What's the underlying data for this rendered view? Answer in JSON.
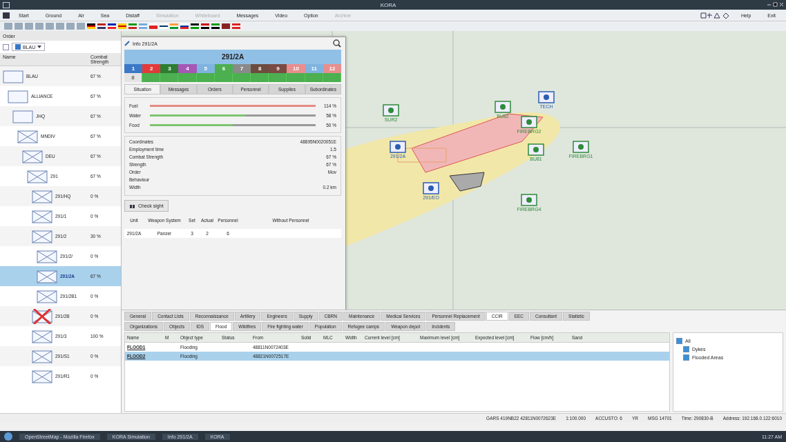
{
  "window": {
    "title": "KORA"
  },
  "menu": {
    "items": [
      {
        "label": "Start",
        "disabled": false
      },
      {
        "label": "Ground",
        "disabled": false
      },
      {
        "label": "Air",
        "disabled": false
      },
      {
        "label": "Sea",
        "disabled": false
      },
      {
        "label": "Distaff",
        "disabled": false
      },
      {
        "label": "Simulation",
        "disabled": true
      },
      {
        "label": "Whiteboard",
        "disabled": true
      },
      {
        "label": "Messages",
        "disabled": false
      },
      {
        "label": "Video",
        "disabled": false
      },
      {
        "label": "Option",
        "disabled": false
      },
      {
        "label": "Archive",
        "disabled": true
      }
    ],
    "right_items": [
      "Help",
      "Exit"
    ]
  },
  "order_panel": {
    "title": "Order",
    "side_dropdown": "BLAU",
    "columns": [
      "Name",
      "Combat Strength"
    ],
    "tree": [
      {
        "name": "BLAU",
        "strength": "67 %",
        "selected": false,
        "destroyed": false,
        "children": [
          {
            "name": "ALLIANCE",
            "strength": "67 %",
            "selected": false,
            "destroyed": false,
            "children": [
              {
                "name": "JHQ",
                "strength": "67 %",
                "selected": false,
                "destroyed": false,
                "children": [
                  {
                    "name": "MNDIV",
                    "strength": "67 %",
                    "selected": false,
                    "destroyed": false,
                    "children": [
                      {
                        "name": "DEU",
                        "strength": "67 %",
                        "selected": false,
                        "destroyed": false,
                        "children": [
                          {
                            "name": "291",
                            "strength": "67 %",
                            "selected": false,
                            "destroyed": false,
                            "children": [
                              {
                                "name": "291/HQ",
                                "strength": "0 %",
                                "selected": false,
                                "destroyed": false
                              },
                              {
                                "name": "291/1",
                                "strength": "0 %",
                                "selected": false,
                                "destroyed": false
                              },
                              {
                                "name": "291/2",
                                "strength": "30 %",
                                "selected": false,
                                "destroyed": false,
                                "children": [
                                  {
                                    "name": "291/2/",
                                    "strength": "0 %",
                                    "selected": false,
                                    "destroyed": false
                                  },
                                  {
                                    "name": "291/2A",
                                    "strength": "67 %",
                                    "selected": true,
                                    "destroyed": false
                                  },
                                  {
                                    "name": "291/2B1",
                                    "strength": "0 %",
                                    "selected": false,
                                    "destroyed": false
                                  }
                                ]
                              },
                              {
                                "name": "291/2B",
                                "strength": "0 %",
                                "selected": false,
                                "destroyed": true
                              },
                              {
                                "name": "291/3",
                                "strength": "100 %",
                                "selected": false,
                                "destroyed": false
                              },
                              {
                                "name": "291/S1",
                                "strength": "0 %",
                                "selected": false,
                                "destroyed": false
                              },
                              {
                                "name": "291/R1",
                                "strength": "0 %",
                                "selected": false,
                                "destroyed": false
                              }
                            ]
                          }
                        ]
                      }
                    ]
                  }
                ]
              }
            ]
          }
        ]
      }
    ]
  },
  "map": {
    "units": [
      {
        "label": "TECH",
        "color": "#2a5db0"
      },
      {
        "label": "SUR2",
        "color": "#2e8b3a"
      },
      {
        "label": "BU82",
        "color": "#2e8b3a"
      },
      {
        "label": "FIREBRG2",
        "color": "#2e8b3a"
      },
      {
        "label": "BU81",
        "color": "#2e8b3a"
      },
      {
        "label": "FIREBRG1",
        "color": "#2e8b3a"
      },
      {
        "label": "FIREBRG4",
        "color": "#2e8b3a"
      },
      {
        "label": "291/2A",
        "color": "#2a5db0"
      },
      {
        "label": "291/EO",
        "color": "#2a5db0"
      }
    ]
  },
  "info_window": {
    "title": "Info 291/2A",
    "unit": "291/2A",
    "status_cells": [
      {
        "label": "1",
        "color": "#3a78c8"
      },
      {
        "label": "2",
        "color": "#e23a3a"
      },
      {
        "label": "3",
        "color": "#2e7d32"
      },
      {
        "label": "4",
        "color": "#a457b5"
      },
      {
        "label": "5",
        "color": "#7fb3e0"
      },
      {
        "label": "6",
        "color": "#4caf50"
      },
      {
        "label": "7",
        "color": "#8a8a8a"
      },
      {
        "label": "8",
        "color": "#6d4c3d"
      },
      {
        "label": "9",
        "color": "#7b4a42"
      },
      {
        "label": "10",
        "color": "#e88e8e"
      },
      {
        "label": "11",
        "color": "#7fb3e0"
      },
      {
        "label": "12",
        "color": "#e88e8e"
      }
    ],
    "row2_label": "8",
    "tabs": [
      {
        "label": "Situation",
        "selected": true
      },
      {
        "label": "Messages",
        "selected": false
      },
      {
        "label": "Orders",
        "selected": false
      },
      {
        "label": "Personnel",
        "selected": false
      },
      {
        "label": "Supplies",
        "selected": false
      },
      {
        "label": "Subordinates",
        "selected": false
      }
    ],
    "supplies": [
      {
        "name": "Fuel",
        "level": 1.0,
        "reading": "114 %",
        "color": "#e58a84"
      },
      {
        "name": "Water",
        "level": 0.58,
        "reading": "58 %",
        "color": "#7cc46e"
      },
      {
        "name": "Food",
        "level": 0.5,
        "reading": "50 %",
        "color": "#7cc46e"
      }
    ],
    "properties": [
      {
        "label": "Coordinates",
        "value": "48895N0020051E"
      },
      {
        "label": "Employment time",
        "value": "1.5"
      },
      {
        "label": "Combat Strength",
        "value": "67 %"
      },
      {
        "label": "Strength",
        "value": "67 %"
      },
      {
        "label": "Order",
        "value": "Mov"
      },
      {
        "label": "Behaviour"
      },
      {
        "label": "Width",
        "value": "0.2 km"
      }
    ],
    "check_sight_button": "Check sight",
    "weapons": {
      "columns": [
        "Unit",
        "Weapon System",
        "Set",
        "Actual",
        "Personnel",
        "Without Personnel"
      ],
      "rows": [
        [
          "291/2A",
          "Panzer",
          "3",
          "2",
          "6",
          ""
        ]
      ]
    }
  },
  "bottom": {
    "tabs": [
      {
        "label": "General",
        "selected": false
      },
      {
        "label": "Contact Lists",
        "selected": false
      },
      {
        "label": "Reconnaissance",
        "selected": false
      },
      {
        "label": "Artillery",
        "selected": false
      },
      {
        "label": "Engineers",
        "selected": false
      },
      {
        "label": "Supply",
        "selected": false
      },
      {
        "label": "CBRN",
        "selected": false
      },
      {
        "label": "Maintenance",
        "selected": false
      },
      {
        "label": "Medical Services",
        "selected": false
      },
      {
        "label": "Personnel Replacement",
        "selected": false
      },
      {
        "label": "CCIR",
        "selected": true
      },
      {
        "label": "EEC",
        "selected": false
      },
      {
        "label": "Consultant",
        "selected": false
      },
      {
        "label": "Statistic",
        "selected": false
      }
    ],
    "subtabs": [
      {
        "label": "Organizations",
        "selected": false
      },
      {
        "label": "Objects",
        "selected": false
      },
      {
        "label": "IDS",
        "selected": false
      },
      {
        "label": "Flood",
        "selected": true
      },
      {
        "label": "Wildfires",
        "selected": false
      },
      {
        "label": "Fire fighting water",
        "selected": false
      },
      {
        "label": "Population",
        "selected": false
      },
      {
        "label": "Refugee camps",
        "selected": false
      },
      {
        "label": "Weapon depot",
        "selected": false
      },
      {
        "label": "Incidents",
        "selected": false
      }
    ],
    "table": {
      "columns": [
        "Name",
        "M",
        "Object type",
        "Status",
        "From",
        "Solid",
        "MLC",
        "Width",
        "Current level [cm]",
        "Maximum level [cm]",
        "Expected level [cm]",
        "Flow [cm/h]",
        "Sand"
      ],
      "rows": [
        {
          "name": "FLOOD1",
          "type": "Flooding",
          "from": "48811N0072403E",
          "selected": false
        },
        {
          "name": "FLOOD2",
          "type": "Flooding",
          "from": "48821N0072517E",
          "selected": true
        }
      ]
    },
    "filter": [
      {
        "label": "All",
        "checked": true,
        "children": [
          {
            "label": "Dykes",
            "checked": true
          },
          {
            "label": "Flooded Areas",
            "checked": true
          }
        ]
      }
    ]
  },
  "status_bar": [
    "GARS 419NB22 42811N0072623E",
    "1:100.000",
    "ACCUSTO: 6",
    "YR",
    "MSG 14701",
    "Time: 290830-B",
    "Address: 192.168.0.122:6010"
  ],
  "taskbar": {
    "items": [
      "OpenStreetMap - Mozilla Firefox",
      "KORA Simulation",
      "Info 291/2A",
      "KORA"
    ],
    "clock": "11:27 AM"
  }
}
